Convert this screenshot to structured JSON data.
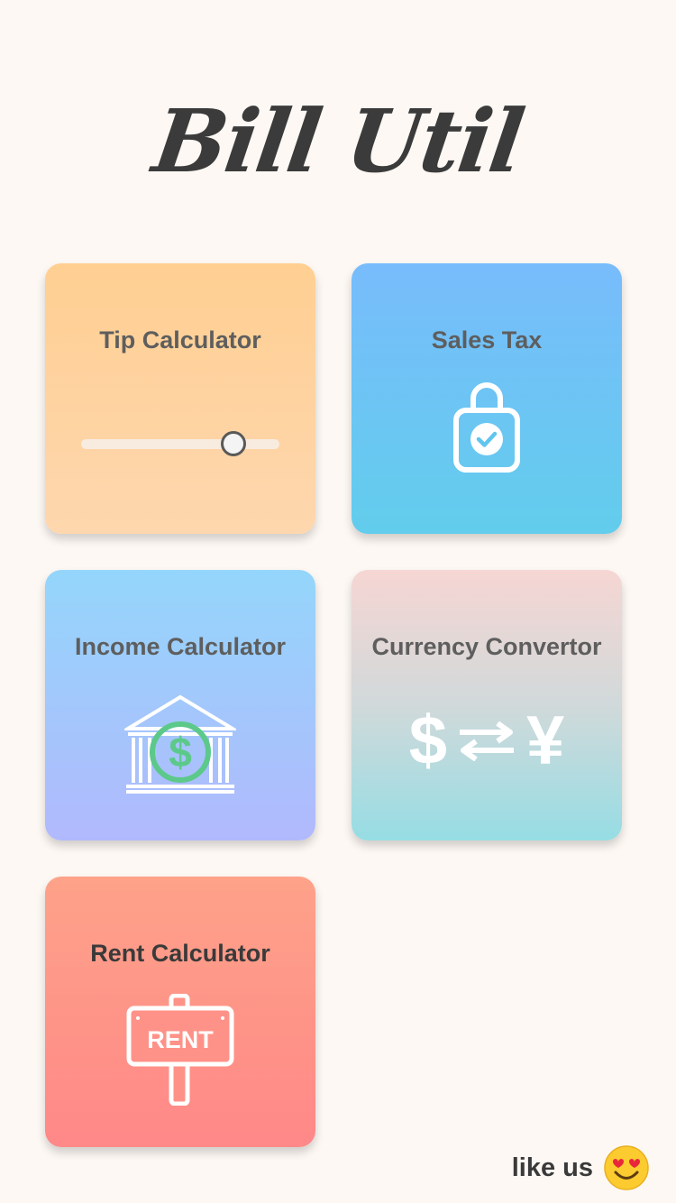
{
  "app": {
    "title": "Bill Util"
  },
  "cards": [
    {
      "id": "tip",
      "title": "Tip Calculator",
      "icon": "slider-icon",
      "slider_value": 0.77
    },
    {
      "id": "sales",
      "title": "Sales Tax",
      "icon": "shopping-bag-check-icon"
    },
    {
      "id": "income",
      "title": "Income Calculator",
      "icon": "bank-dollar-icon"
    },
    {
      "id": "currency",
      "title": "Currency Convertor",
      "icon": "currency-exchange-icon",
      "from_symbol": "$",
      "to_symbol": "¥",
      "exchange_glyph": "⇄"
    },
    {
      "id": "rent",
      "title": "Rent Calculator",
      "icon": "rent-sign-icon",
      "sign_text": "RENT"
    }
  ],
  "footer": {
    "like_label": "like us",
    "emoji_icon": "heart-eyes-emoji-icon"
  },
  "colors": {
    "background": "#fdf8f4",
    "title": "#3b3b3b",
    "tip_card": "#ffcf92",
    "sales_card": "#78bcfc",
    "income_card": "#94d6fb",
    "currency_card": "#96dde4",
    "rent_card": "#ff8888",
    "income_accent": "#5cc98a"
  }
}
